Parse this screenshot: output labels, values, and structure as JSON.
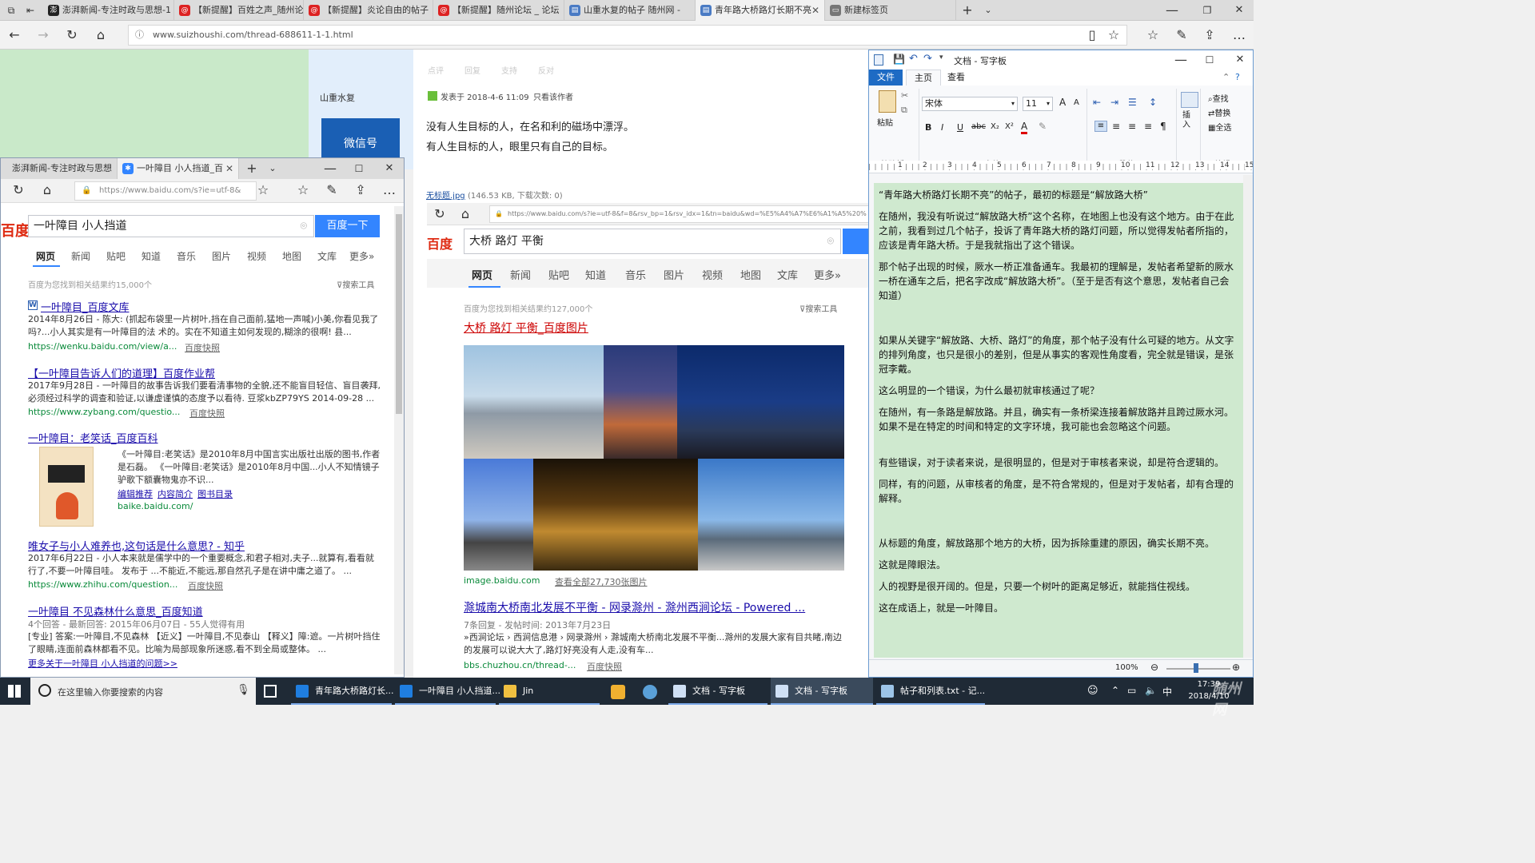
{
  "main_tabs": [
    {
      "label": "澎湃新闻-专注时政与思想-1"
    },
    {
      "label": "【新提醒】百姓之声_随州论"
    },
    {
      "label": "【新提醒】炎论自由的帖子"
    },
    {
      "label": "【新提醒】随州论坛 _ 论坛"
    },
    {
      "label": "山重水复的帖子 随州网 -"
    },
    {
      "label": "青年路大桥路灯长期不亮"
    },
    {
      "label": "新建标签页"
    }
  ],
  "main_url": "www.suizhoushi.com/thread-688611-1-1.html",
  "forum": {
    "actions": [
      "点评",
      "回复",
      "支持",
      "反对"
    ],
    "poster": "山重水复",
    "wechat": "微信号",
    "post_meta": "发表于 2018-4-6 11:09",
    "only_author": "只看该作者",
    "quote1": "没有人生目标的人，在名和利的磁场中漂浮。",
    "quote2": "有人生目标的人，眼里只有自己的目标。",
    "attachment": "无标题.jpg",
    "attachment_meta": "(146.53 KB, 下载次数: 0)"
  },
  "e2": {
    "tab1": "澎湃新闻-专注时政与思想",
    "tab2": "一叶障目 小人挡道_百",
    "url": "https://www.baidu.com/s?ie=utf-8&",
    "logo": "百度",
    "query": "一叶障目 小人挡道",
    "button": "百度一下",
    "nav": [
      "网页",
      "新闻",
      "贴吧",
      "知道",
      "音乐",
      "图片",
      "视频",
      "地图",
      "文库",
      "更多»"
    ],
    "count": "百度为您找到相关结果约15,000个",
    "tools": "搜索工具",
    "results": [
      {
        "title": "一叶障目_百度文库",
        "text": "2014年8月26日 - 陈大: (抓起布袋里一片树叶,挡在自己面前,猛地一声喊)小美,你看见我了吗?...小人其实是有一叶障目的法 术的。实在不知道主如何发现的,糊涂的很啊! 县...",
        "url": "https://wenku.baidu.com/view/a...",
        "snap": "百度快照"
      },
      {
        "title": "【一叶障目告诉人们的道理】百度作业帮",
        "text": "2017年9月28日 - 一叶障目的故事告诉我们要看清事物的全貌,还不能盲目轻信、盲目袭拜,必须经过科学的调查和验证,以谦虚谨慎的态度予以看待. 豆浆kbZP79YS 2014-09-28 ...",
        "url": "https://www.zybang.com/questio...",
        "snap": "百度快照"
      },
      {
        "title": "一叶障目：老笑话_百度百科",
        "text": "《一叶障目:老笑话》是2010年8月中国言实出版社出版的图书,作者是石磊。 《一叶障目:老笑话》是2010年8月中国...小人不知情镜子驴歌下额囊物鬼亦不识...",
        "links": [
          "编辑推荐",
          "内容简介",
          "图书目录"
        ],
        "url": "baike.baidu.com/",
        "snap": ""
      },
      {
        "title": "唯女子与小人难养也,这句话是什么意思? - 知乎",
        "text": "2017年6月22日 - 小人本来就是儒学中的一个重要概念,和君子相对,夫子...就算有,看看就行了,不要一叶障目哇。 发布于 ...不能近,不能远,那自然孔子是在讲中庸之道了。 ...",
        "url": "https://www.zhihu.com/question...",
        "snap": "百度快照"
      },
      {
        "title": "一叶障目 不见森林什么意思_百度知道",
        "text": "4个回答 - 最新回答: 2015年06月07日 - 55人觉得有用",
        "text2": "[专业] 答案:一叶障目,不见森林 【近义】一叶障目,不见泰山 【释义】障:遮。一片树叶挡住了眼睛,连面前森林都看不见。比喻为局部现象所迷惑,看不到全局或整体。 ...",
        "url": "",
        "snap": ""
      }
    ],
    "more": "更多关于一叶障目 小人挡道的问题>>"
  },
  "b2": {
    "url": "https://www.baidu.com/s?ie=utf-8&f=8&rsv_bp=1&rsv_idx=1&tn=baidu&wd=%E5%A4%A7%E6%A1%A5%20%",
    "logo": "百度",
    "query": "大桥 路灯 平衡",
    "nav": [
      "网页",
      "新闻",
      "贴吧",
      "知道",
      "音乐",
      "图片",
      "视频",
      "地图",
      "文库",
      "更多»"
    ],
    "count": "百度为您找到相关结果约127,000个",
    "tools": "搜索工具",
    "img_title": "大桥 路灯 平衡_百度图片",
    "img_url": "image.baidu.com",
    "img_more": "查看全部27,730张图片",
    "r2_title": "滁城南大桥南北发展不平衡 - 网录滁州 - 滁州西涧论坛 - Powered ...",
    "r2_meta": "7条回复 - 发帖时间: 2013年7月23日",
    "r2_text": "»西涧论坛 › 西涧信息港 › 网录滁州 › 滁城南大桥南北发展不平衡...滁州的发展大家有目共睹,南边的发展可以说大大了,路灯好亮没有人走,没有车...",
    "r2_url": "bbs.chuzhou.cn/thread-...",
    "r2_snap": "百度快照"
  },
  "wordpad": {
    "title": "文档 - 写字板",
    "menu": [
      "文件",
      "主页",
      "查看"
    ],
    "font": "宋体",
    "size": "11",
    "groups": [
      "剪贴板",
      "字体",
      "段落",
      "编辑"
    ],
    "paste": "粘贴",
    "insert": "插入",
    "edit": [
      "查找",
      "替换",
      "全选"
    ],
    "zoom": "100%",
    "paragraphs": [
      "“青年路大桥路灯长期不亮”的帖子，最初的标题是“解放路大桥”",
      "在随州，我没有听说过“解放路大桥”这个名称，在地图上也没有这个地方。由于在此之前，我看到过几个帖子，投诉了青年路大桥的路灯问题，所以觉得发帖者所指的，应该是青年路大桥。于是我就指出了这个错误。",
      "那个帖子出现的时候，厥水一桥正准备通车。我最初的理解是，发帖者希望新的厥水一桥在通车之后，把名字改成“解放路大桥”。（至于是否有这个意思，发帖者自己会知道）",
      "如果从关键字“解放路、大桥、路灯”的角度，那个帖子没有什么可疑的地方。从文字的排列角度，也只是很小的差别，但是从事实的客观性角度看，完全就是错误，是张冠李戴。",
      "这么明显的一个错误，为什么最初就审核通过了呢？",
      "在随州，有一条路是解放路。并且，确实有一条桥梁连接着解放路并且跨过厥水河。如果不是在特定的时间和特定的文字环境，我可能也会忽略这个问题。",
      "有些错误，对于读者来说，是很明显的，但是对于审核者来说，却是符合逻辑的。",
      "同样，有的问题，从审核者的角度，是不符合常规的，但是对于发帖者，却有合理的解释。",
      "从标题的角度，解放路那个地方的大桥，因为拆除重建的原因，确实长期不亮。",
      "这就是障眼法。",
      "人的视野是很开阔的。但是，只要一个树叶的距离足够近，就能挡住视线。",
      "这在成语上，就是一叶障目。"
    ],
    "ruler": [
      "1",
      "2",
      "3",
      "4",
      "5",
      "6",
      "7",
      "8",
      "9",
      "10",
      "11",
      "12",
      "13",
      "14",
      "15"
    ]
  },
  "taskbar": {
    "search": "在这里输入你要搜索的内容",
    "items": [
      "青年路大桥路灯长...",
      "一叶障目 小人挡道...",
      "Jin",
      "文档 - 写字板",
      "文档 - 写字板",
      "帖子和列表.txt - 记..."
    ],
    "time": "17:39",
    "date": "2018/4/10",
    "ime": "中",
    "watermark": "随州网"
  }
}
